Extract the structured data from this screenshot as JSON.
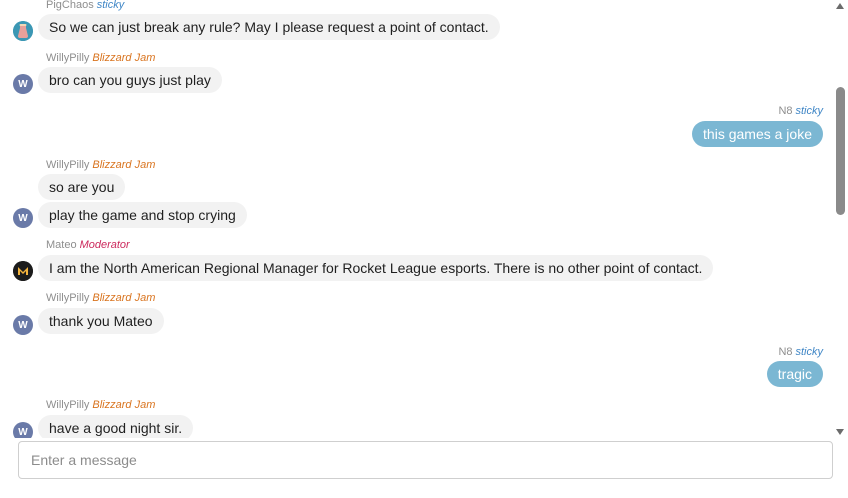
{
  "messages": [
    {
      "type": "meta",
      "author": "PigChaos",
      "role": "sticky"
    },
    {
      "type": "in",
      "text": "So we can just break any rule? May I please request a point of contact."
    },
    {
      "type": "meta",
      "author": "WillyPilly",
      "role": "Blizzard Jam"
    },
    {
      "type": "in",
      "text": "bro can you guys just play"
    },
    {
      "type": "meta",
      "author": "N8",
      "role": "sticky"
    },
    {
      "type": "out",
      "text": "this games a joke"
    },
    {
      "type": "meta",
      "author": "WillyPilly",
      "role": "Blizzard Jam"
    },
    {
      "type": "in",
      "text": "so are you"
    },
    {
      "type": "in",
      "text": "play the game and stop crying"
    },
    {
      "type": "meta",
      "author": "Mateo",
      "role": "Moderator"
    },
    {
      "type": "in",
      "text": "I am the North American Regional Manager for Rocket League esports. There is no other point of contact."
    },
    {
      "type": "meta",
      "author": "WillyPilly",
      "role": "Blizzard Jam"
    },
    {
      "type": "in",
      "text": "thank you Mateo"
    },
    {
      "type": "meta",
      "author": "N8",
      "role": "sticky"
    },
    {
      "type": "out",
      "text": "tragic"
    },
    {
      "type": "meta",
      "author": "WillyPilly",
      "role": "Blizzard Jam"
    },
    {
      "type": "in",
      "text": "have a good night sir."
    }
  ],
  "avatars": {
    "pigchaos": {
      "icon": "pig-avatar-icon"
    },
    "willypilly": {
      "letter": "W",
      "color": "#6a7aa8"
    },
    "mateo": {
      "letter": "M",
      "color": "#1c1c1c",
      "accent": "#f2b33d"
    }
  },
  "composer": {
    "placeholder": "Enter a message"
  },
  "colors": {
    "sticky": "#3f86c6",
    "blizzard_jam": "#d9741f",
    "moderator": "#cc2a5d",
    "outgoing_bubble": "#7bb7d3",
    "incoming_bubble": "#f2f2f2"
  }
}
